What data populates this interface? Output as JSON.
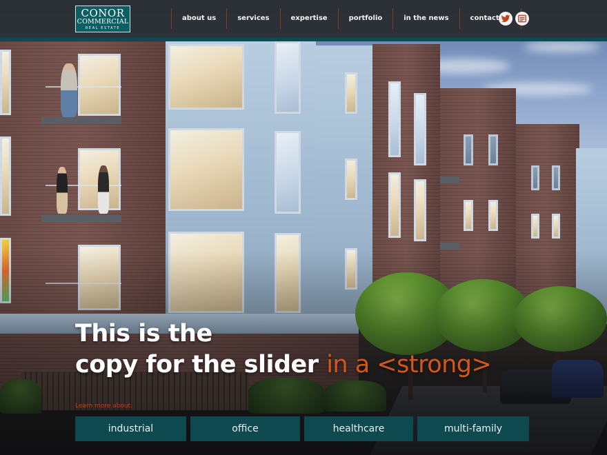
{
  "brand": {
    "logo_line1": "CONOR",
    "logo_line2": "COMMERCIAL",
    "logo_line3": "REAL ESTATE"
  },
  "nav": {
    "items": [
      {
        "label": "about us"
      },
      {
        "label": "services"
      },
      {
        "label": "expertise"
      },
      {
        "label": "portfolio"
      },
      {
        "label": "in the news"
      },
      {
        "label": "contact us"
      }
    ]
  },
  "social": {
    "icons": [
      "twitter-icon",
      "rss-icon"
    ]
  },
  "slider": {
    "line1": "This is the",
    "line2_plain": "copy for the slider",
    "line2_accent": "in a <strong>",
    "learn_more": "Learn more about:"
  },
  "categories": [
    {
      "label": "industrial"
    },
    {
      "label": "office"
    },
    {
      "label": "healthcare"
    },
    {
      "label": "multi-family"
    }
  ],
  "colors": {
    "accent": "#d4561f",
    "teal": "#0e4950",
    "header": "#26282a"
  }
}
